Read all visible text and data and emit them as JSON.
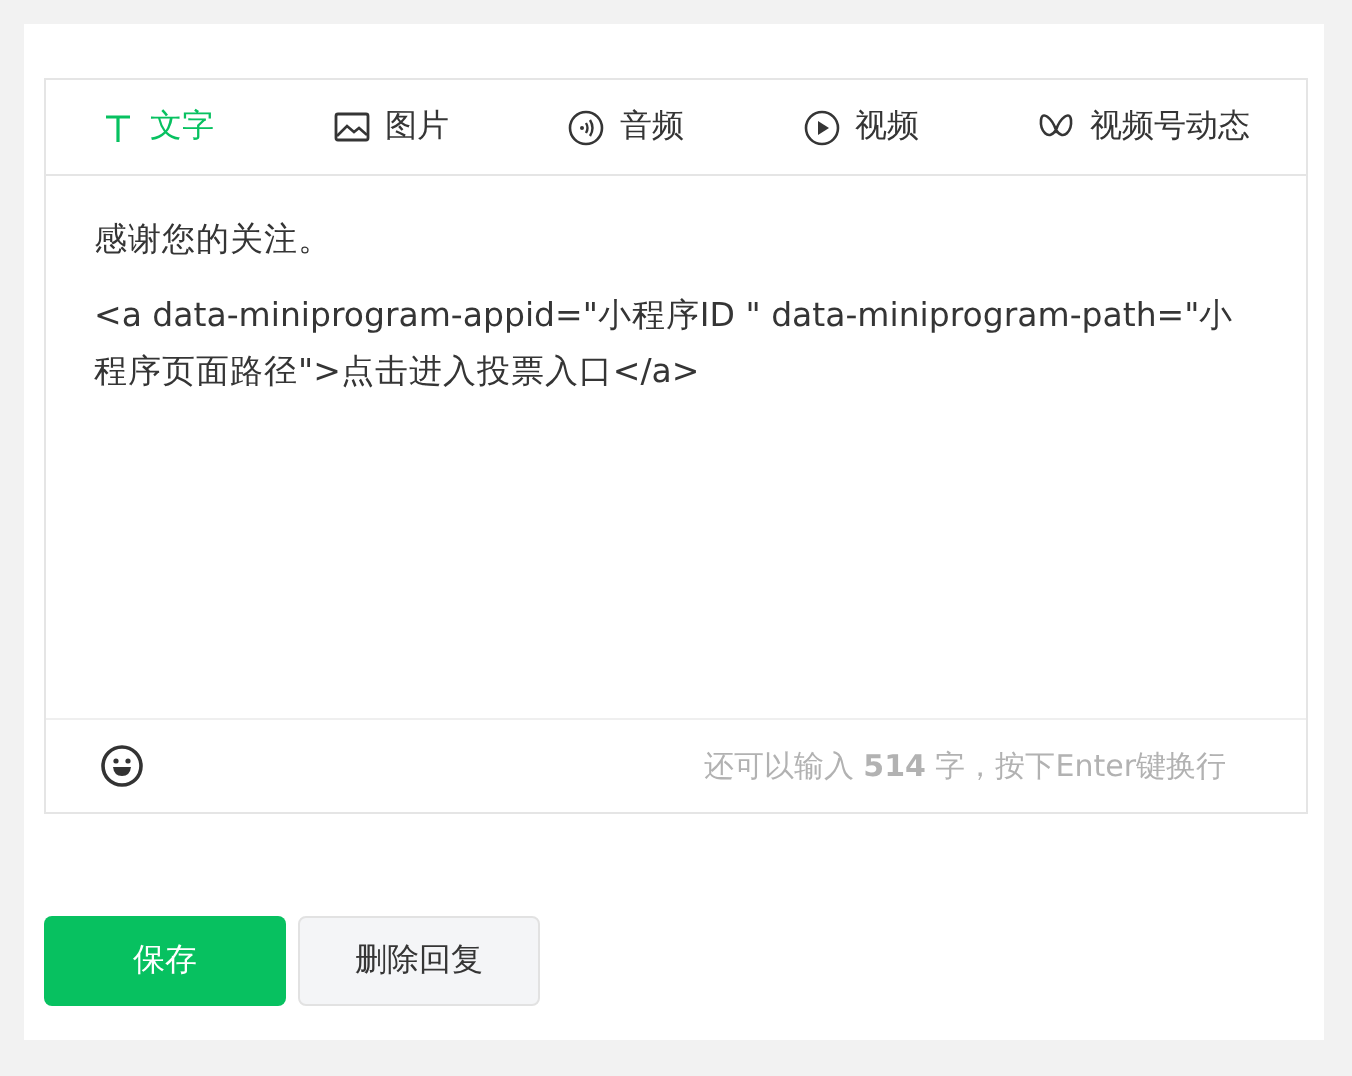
{
  "tabs": [
    {
      "label": "文字",
      "kind": "text",
      "selected": true
    },
    {
      "label": "图片",
      "kind": "image",
      "selected": false
    },
    {
      "label": "音频",
      "kind": "audio",
      "selected": false
    },
    {
      "label": "视频",
      "kind": "video",
      "selected": false
    },
    {
      "label": "视频号动态",
      "kind": "channels",
      "selected": false
    }
  ],
  "content": [
    "感谢您的关注。",
    "<a data-miniprogram-appid=\"小程序ID \" data-miniprogram-path=\"小程序页面路径\">点击进入投票入口</a>"
  ],
  "counter": "还可以输入 **514** 字，按下Enter键换行",
  "buttons": [
    {
      "label": "保存",
      "kind": "primary"
    },
    {
      "label": "删除回复",
      "kind": "secondary"
    }
  ]
}
